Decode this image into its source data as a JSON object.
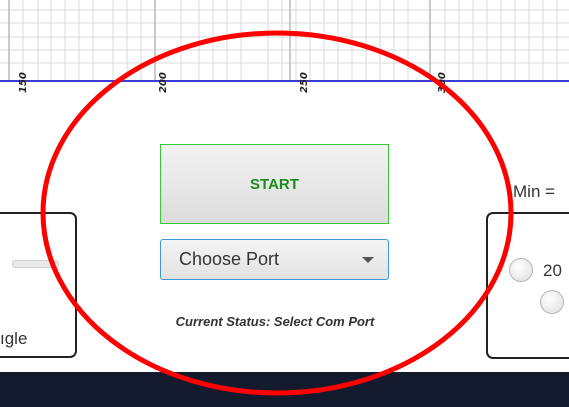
{
  "graph": {
    "tick_labels": [
      "150",
      "200",
      "250",
      "300"
    ]
  },
  "controls": {
    "start_label": "START",
    "port_select_value": "Choose Port",
    "status_text": "Current Status: Select Com Port"
  },
  "left_panel": {
    "label_fragment": "ıgle"
  },
  "right_panel": {
    "min_label": "Min =",
    "radio_label_1": "20"
  },
  "colors": {
    "axis_line": "#3b3bd6",
    "start_text": "#1c8a1c",
    "start_border": "#33cc33",
    "select_border": "#3b99d8",
    "annotation_ellipse": "#ff0000",
    "bottom_bar": "#131a2e"
  }
}
